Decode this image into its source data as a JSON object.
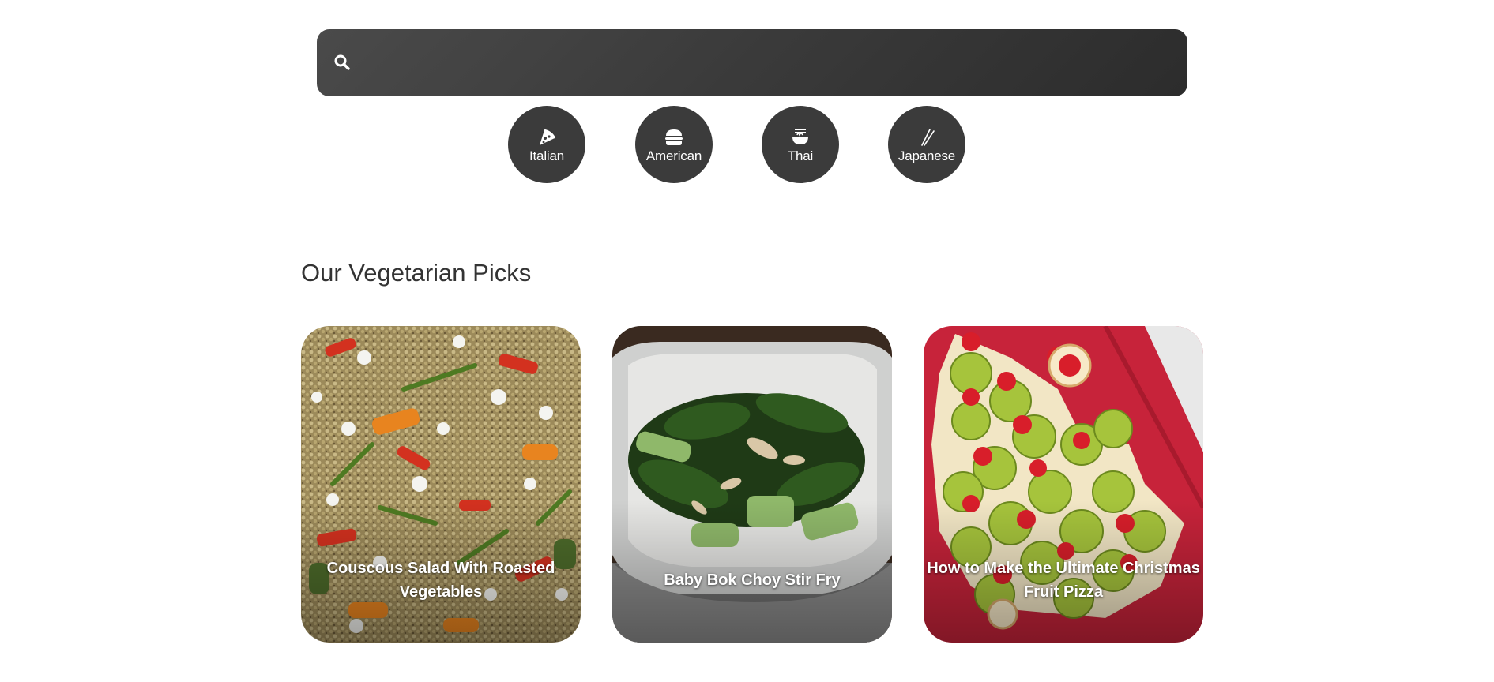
{
  "search": {
    "placeholder": "",
    "value": "",
    "icon": "search-icon"
  },
  "cuisines": [
    {
      "label": "Italian",
      "icon": "pizza-slice-icon"
    },
    {
      "label": "American",
      "icon": "burger-icon"
    },
    {
      "label": "Thai",
      "icon": "noodle-bowl-icon"
    },
    {
      "label": "Japanese",
      "icon": "chopsticks-icon"
    }
  ],
  "section": {
    "title": "Our Vegetarian Picks"
  },
  "recipes": [
    {
      "title": "Couscous Salad With Roasted Vegetables",
      "image": "couscous-salad-photo"
    },
    {
      "title": "Baby Bok Choy Stir Fry",
      "image": "bok-choy-stir-fry-photo"
    },
    {
      "title": "How to Make the Ultimate Christmas Fruit Pizza",
      "image": "christmas-fruit-pizza-photo"
    }
  ],
  "colors": {
    "search_bar": "#3a3a3a",
    "cuisine_button": "#3b3b3b",
    "text": "#333333"
  }
}
